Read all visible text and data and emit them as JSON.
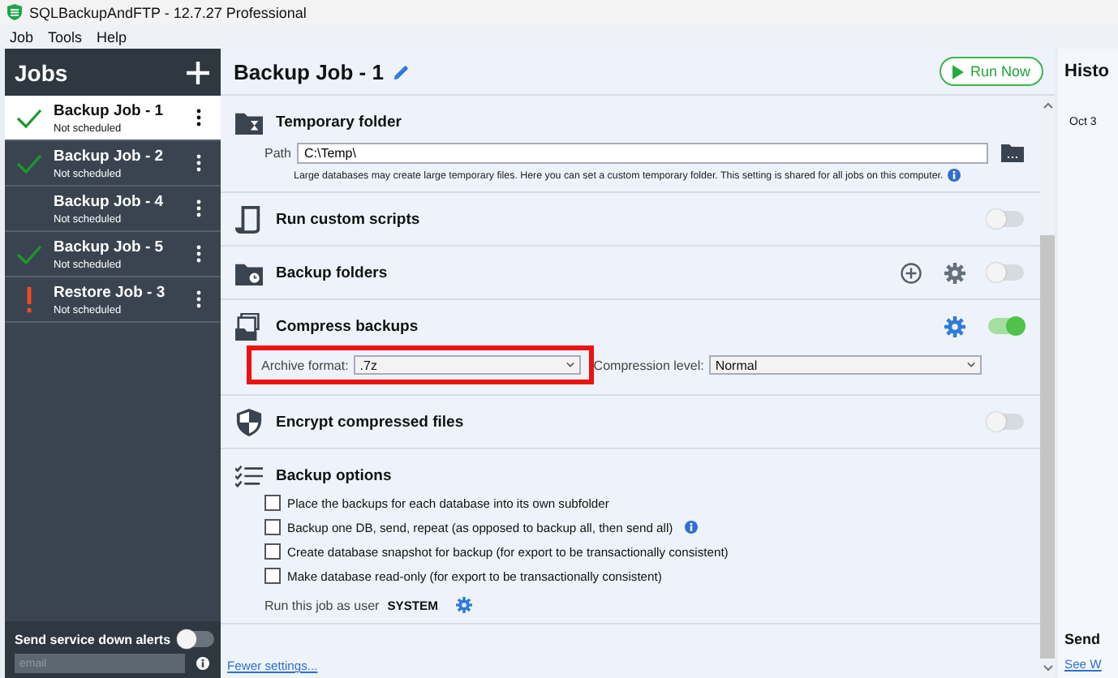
{
  "window": {
    "title": "SQLBackupAndFTP - 12.7.27 Professional"
  },
  "menu": [
    "Job",
    "Tools",
    "Help"
  ],
  "sidebar": {
    "title": "Jobs",
    "jobs": [
      {
        "name": "Backup Job - 1",
        "schedule": "Not scheduled",
        "kind": "success",
        "selected": true
      },
      {
        "name": "Backup Job - 2",
        "schedule": "Not scheduled",
        "kind": "success",
        "selected": false
      },
      {
        "name": "Backup Job - 4",
        "schedule": "Not scheduled",
        "kind": "idle",
        "selected": false
      },
      {
        "name": "Backup Job - 5",
        "schedule": "Not scheduled",
        "kind": "success",
        "selected": false
      },
      {
        "name": "Restore Job - 3",
        "schedule": "Not scheduled",
        "kind": "error",
        "selected": false
      }
    ],
    "alerts": {
      "label": "Send service down alerts",
      "on": false,
      "placeholder": "email"
    }
  },
  "job": {
    "title": "Backup Job - 1",
    "run_button": "Run Now",
    "sections": [
      {
        "kind": "temp",
        "title": "Temporary folder",
        "path_label": "Path",
        "path": "C:\\Temp\\",
        "note": "Large databases may create large temporary files. Here you can set a custom temporary folder. This setting is shared for all jobs on this computer."
      },
      {
        "kind": "scripts",
        "title": "Run custom scripts",
        "on": false
      },
      {
        "kind": "folders",
        "title": "Backup folders",
        "on": false
      },
      {
        "kind": "compress",
        "title": "Compress backups",
        "on": true,
        "format_label": "Archive format:",
        "format": ".7z",
        "level_label": "Compression level:",
        "level_value": "Normal"
      },
      {
        "kind": "encrypt",
        "title": "Encrypt compressed files",
        "on": false
      },
      {
        "kind": "options",
        "title": "Backup options",
        "options": [
          {
            "label": "Place the backups for each database into its own subfolder",
            "checked": false,
            "info": false
          },
          {
            "label": "Backup one DB, send, repeat (as opposed to backup all, then send all)",
            "checked": false,
            "info": true
          },
          {
            "label": "Create database snapshot for backup (for export to be transactionally consistent)",
            "checked": false,
            "info": false
          },
          {
            "label": "Make database read-only (for export to be transactionally consistent)",
            "checked": false,
            "info": false
          }
        ],
        "run_as_label": "Run this job as user",
        "run_as_user": "SYSTEM"
      }
    ],
    "fewer_link": "Fewer settings..."
  },
  "history": {
    "title": "Histo",
    "entries": [
      "Oct 3"
    ],
    "send_title": "Send",
    "link": "See W"
  }
}
